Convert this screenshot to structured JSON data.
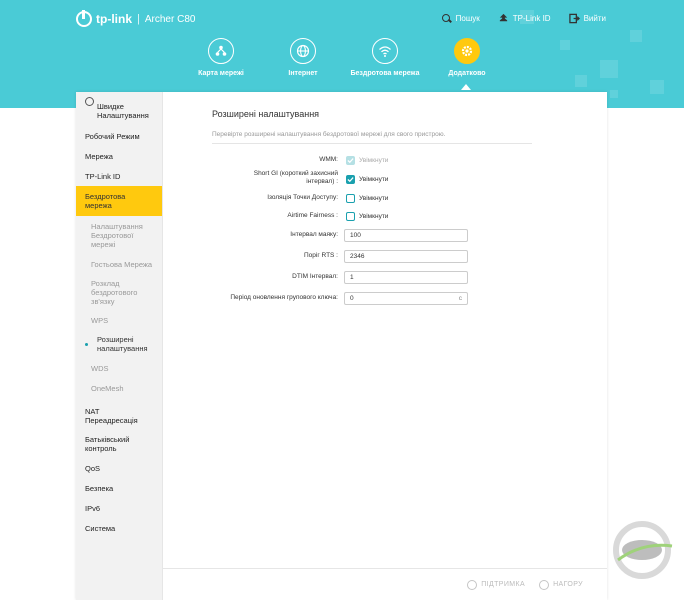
{
  "header": {
    "brand": "tp-link",
    "separator": "|",
    "model": "Archer C80",
    "links": [
      {
        "label": "Пошук",
        "icon": "search-icon"
      },
      {
        "label": "TP-Link ID",
        "icon": "user-icon"
      },
      {
        "label": "Вийти",
        "icon": "logout-icon"
      }
    ],
    "tabs": [
      {
        "label": "Карта мережі",
        "icon": "network-map-icon"
      },
      {
        "label": "Інтернет",
        "icon": "globe-icon"
      },
      {
        "label": "Бездротова мережа",
        "icon": "wifi-icon"
      },
      {
        "label": "Додатково",
        "icon": "gear-icon",
        "active": true
      }
    ]
  },
  "sidebar": {
    "items": [
      {
        "label": "Швидке Налаштування",
        "icon": "gear-icon"
      },
      {
        "label": "Робочий Режим"
      },
      {
        "label": "Мережа"
      },
      {
        "label": "TP-Link ID"
      },
      {
        "label": "Бездротова мережа",
        "active": true
      },
      {
        "label": "Налаштування Бездротової мережі",
        "sub": true
      },
      {
        "label": "Гостьова Мережа",
        "sub": true
      },
      {
        "label": "Розклад бездротового зв'язку",
        "sub": true
      },
      {
        "label": "WPS",
        "sub": true
      },
      {
        "label": "Розширені налаштування",
        "sub": true,
        "current": true
      },
      {
        "label": "WDS",
        "sub": true
      },
      {
        "label": "OneMesh",
        "sub": true
      },
      {
        "label": "NAT Переадресація"
      },
      {
        "label": "Батьківський контроль"
      },
      {
        "label": "QoS"
      },
      {
        "label": "Безпека"
      },
      {
        "label": "IPv6"
      },
      {
        "label": "Система"
      }
    ]
  },
  "main": {
    "title": "Розширені налаштування",
    "description": "Перевірте розширені налаштування бездротової мережі для свого пристрою.",
    "fields": {
      "wmm": {
        "label": "WMM:",
        "value": "Увімкнути",
        "checked": true,
        "disabled": true
      },
      "short_gi": {
        "label": "Short GI (короткий захисний інтервал) :",
        "value": "Увімкнути",
        "checked": true
      },
      "ap_isolation": {
        "label": "Ізоляція Точки Доступу:",
        "value": "Увімкнути",
        "checked": false
      },
      "airtime": {
        "label": "Airtime Fairness :",
        "value": "Увімкнути",
        "checked": false
      },
      "beacon": {
        "label": "Інтервал маяку:",
        "value": "100"
      },
      "rts": {
        "label": "Поріг RTS :",
        "value": "2346"
      },
      "dtim": {
        "label": "DTIM Інтервал:",
        "value": "1"
      },
      "group_key": {
        "label": "Період оновлення групового ключа:",
        "value": "0",
        "unit": "с"
      }
    }
  },
  "footer": {
    "support": "ПІДТРИМКА",
    "top": "НАГОРУ"
  },
  "colors": {
    "header": "#4acbd6",
    "accent": "#ffc90e",
    "teal": "#1aa0ae"
  }
}
